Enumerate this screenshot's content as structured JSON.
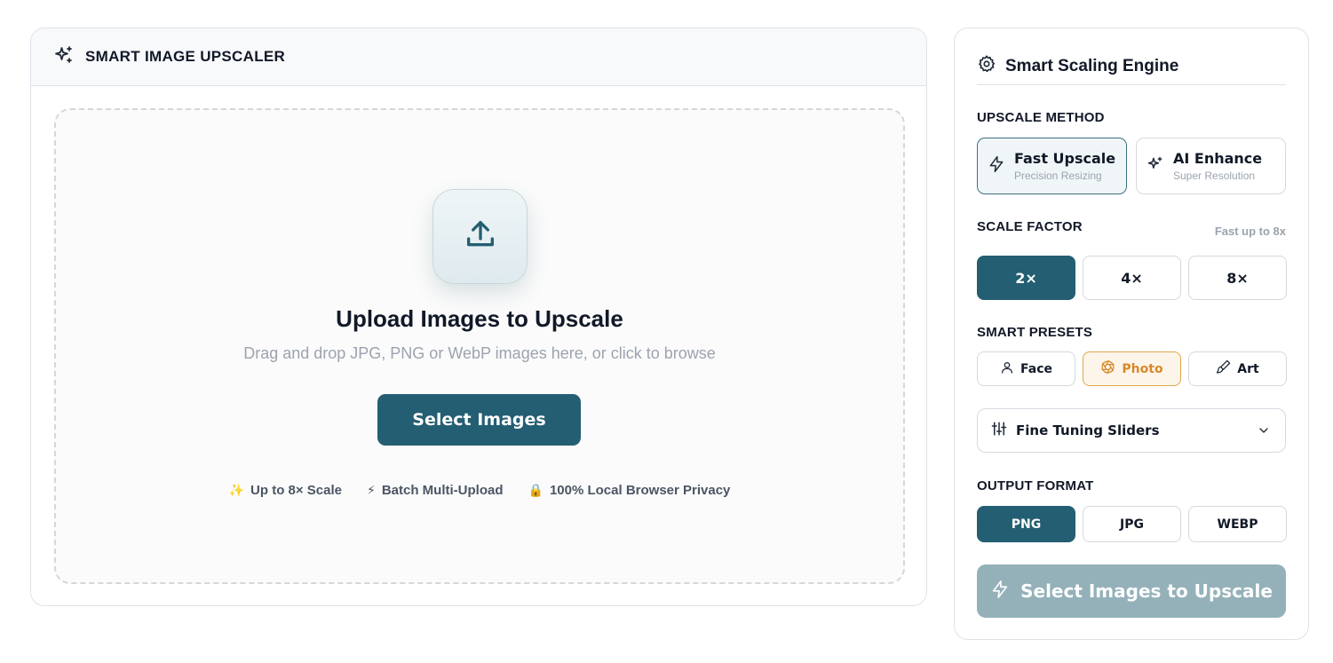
{
  "main": {
    "title": "SMART IMAGE UPSCALER",
    "dropzone": {
      "title": "Upload Images to Upscale",
      "subtitle": "Drag and drop JPG, PNG or WebP images here, or click to browse",
      "button_label": "Select Images",
      "features": [
        {
          "emoji": "✨",
          "label": "Up to 8× Scale"
        },
        {
          "emoji": "⚡",
          "label": "Batch Multi-Upload"
        },
        {
          "emoji": "🔒",
          "label": "100% Local Browser Privacy"
        }
      ]
    }
  },
  "sidebar": {
    "title": "Smart Scaling Engine",
    "upscale_method": {
      "label": "UPSCALE METHOD",
      "options": [
        {
          "title": "Fast Upscale",
          "subtitle": "Precision Resizing",
          "active": true
        },
        {
          "title": "AI Enhance",
          "subtitle": "Super Resolution",
          "active": false
        }
      ]
    },
    "scale_factor": {
      "label": "SCALE FACTOR",
      "note": "Fast up to 8x",
      "options": [
        "2×",
        "4×",
        "8×"
      ],
      "selected": "2×"
    },
    "smart_presets": {
      "label": "SMART PRESETS",
      "options": [
        "Face",
        "Photo",
        "Art"
      ],
      "selected": "Photo"
    },
    "fine_tuning": {
      "label": "Fine Tuning Sliders"
    },
    "output_format": {
      "label": "OUTPUT FORMAT",
      "options": [
        "PNG",
        "JPG",
        "WEBP"
      ],
      "selected": "PNG"
    },
    "cta_label": "Select Images to Upscale"
  },
  "colors": {
    "accent": "#245e72",
    "preset_active": "#d6892a",
    "cta_disabled": "#94b1b9"
  }
}
